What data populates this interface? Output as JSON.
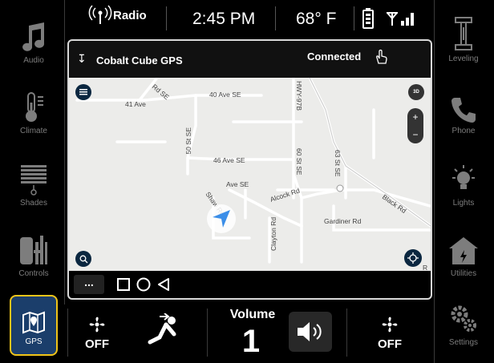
{
  "status_bar": {
    "radio_label": "Radio",
    "time": "2:45 PM",
    "temperature": "68° F"
  },
  "left_nav": [
    {
      "label": "Audio",
      "icon": "music-note-icon"
    },
    {
      "label": "Climate",
      "icon": "thermometer-icon"
    },
    {
      "label": "Shades",
      "icon": "shades-icon"
    },
    {
      "label": "Controls",
      "icon": "controls-icon"
    },
    {
      "label": "GPS",
      "icon": "map-pin-icon",
      "active": true
    }
  ],
  "right_nav": [
    {
      "label": "Leveling",
      "icon": "leveling-icon"
    },
    {
      "label": "Phone",
      "icon": "phone-icon"
    },
    {
      "label": "Lights",
      "icon": "light-bulb-icon"
    },
    {
      "label": "Utilities",
      "icon": "utilities-icon"
    },
    {
      "label": "Settings",
      "icon": "gears-icon"
    }
  ],
  "gps": {
    "device_name": "Cobalt Cube GPS",
    "connection_status": "Connected",
    "view_mode": "3D",
    "roads": [
      "Rd SE",
      "41 Ave",
      "40 Ave SE",
      "HWY-97B",
      "63 St SE",
      "50 St SE",
      "46 Ave SE",
      "60 St SE",
      "Ave SE",
      "Alcock Rd",
      "Shaw Rd",
      "Black Rd",
      "Gardiner Rd",
      "Clayton Rd",
      "R"
    ],
    "zoom_in": "+",
    "zoom_out": "−",
    "more": "..."
  },
  "bottom_bar": {
    "fan_left": "OFF",
    "volume_label": "Volume",
    "volume_value": "1",
    "fan_right": "OFF"
  },
  "colors": {
    "active_border": "#f0c419",
    "active_bg": "#1b3e6b",
    "inactive_text": "#7d7d7d",
    "map_bg": "#ececea",
    "nav_arrow": "#3b8ee8"
  }
}
